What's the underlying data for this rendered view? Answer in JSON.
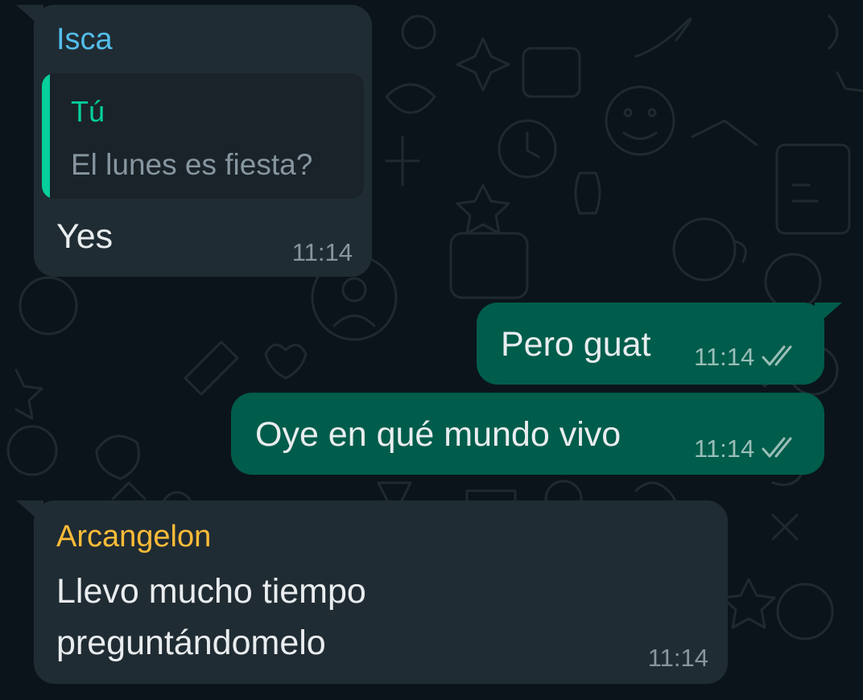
{
  "colors": {
    "chat_background": "#0b141a",
    "incoming_bubble": "#202c33",
    "outgoing_bubble": "#005c4b",
    "quote_background": "#1a2329",
    "message_text": "#e9edef",
    "meta_text": "#8696a0",
    "outgoing_meta_text": "#99beb7",
    "sender_isca": "#53bdeb",
    "sender_arcangelon": "#ffbc38",
    "quote_accent": "#06cf9c"
  },
  "messages": [
    {
      "direction": "incoming",
      "sender": "Isca",
      "quoted": {
        "author": "Tú",
        "text": "El lunes es fiesta?"
      },
      "text": "Yes",
      "time": "11:14"
    },
    {
      "direction": "outgoing",
      "text": "Pero guat",
      "time": "11:14",
      "status_icon": "double-check-icon"
    },
    {
      "direction": "outgoing",
      "text": "Oye en qué mundo vivo",
      "time": "11:14",
      "status_icon": "double-check-icon"
    },
    {
      "direction": "incoming",
      "sender": "Arcangelon",
      "text_lines": [
        "Llevo mucho tiempo",
        "preguntándomelo"
      ],
      "time": "11:14"
    }
  ]
}
